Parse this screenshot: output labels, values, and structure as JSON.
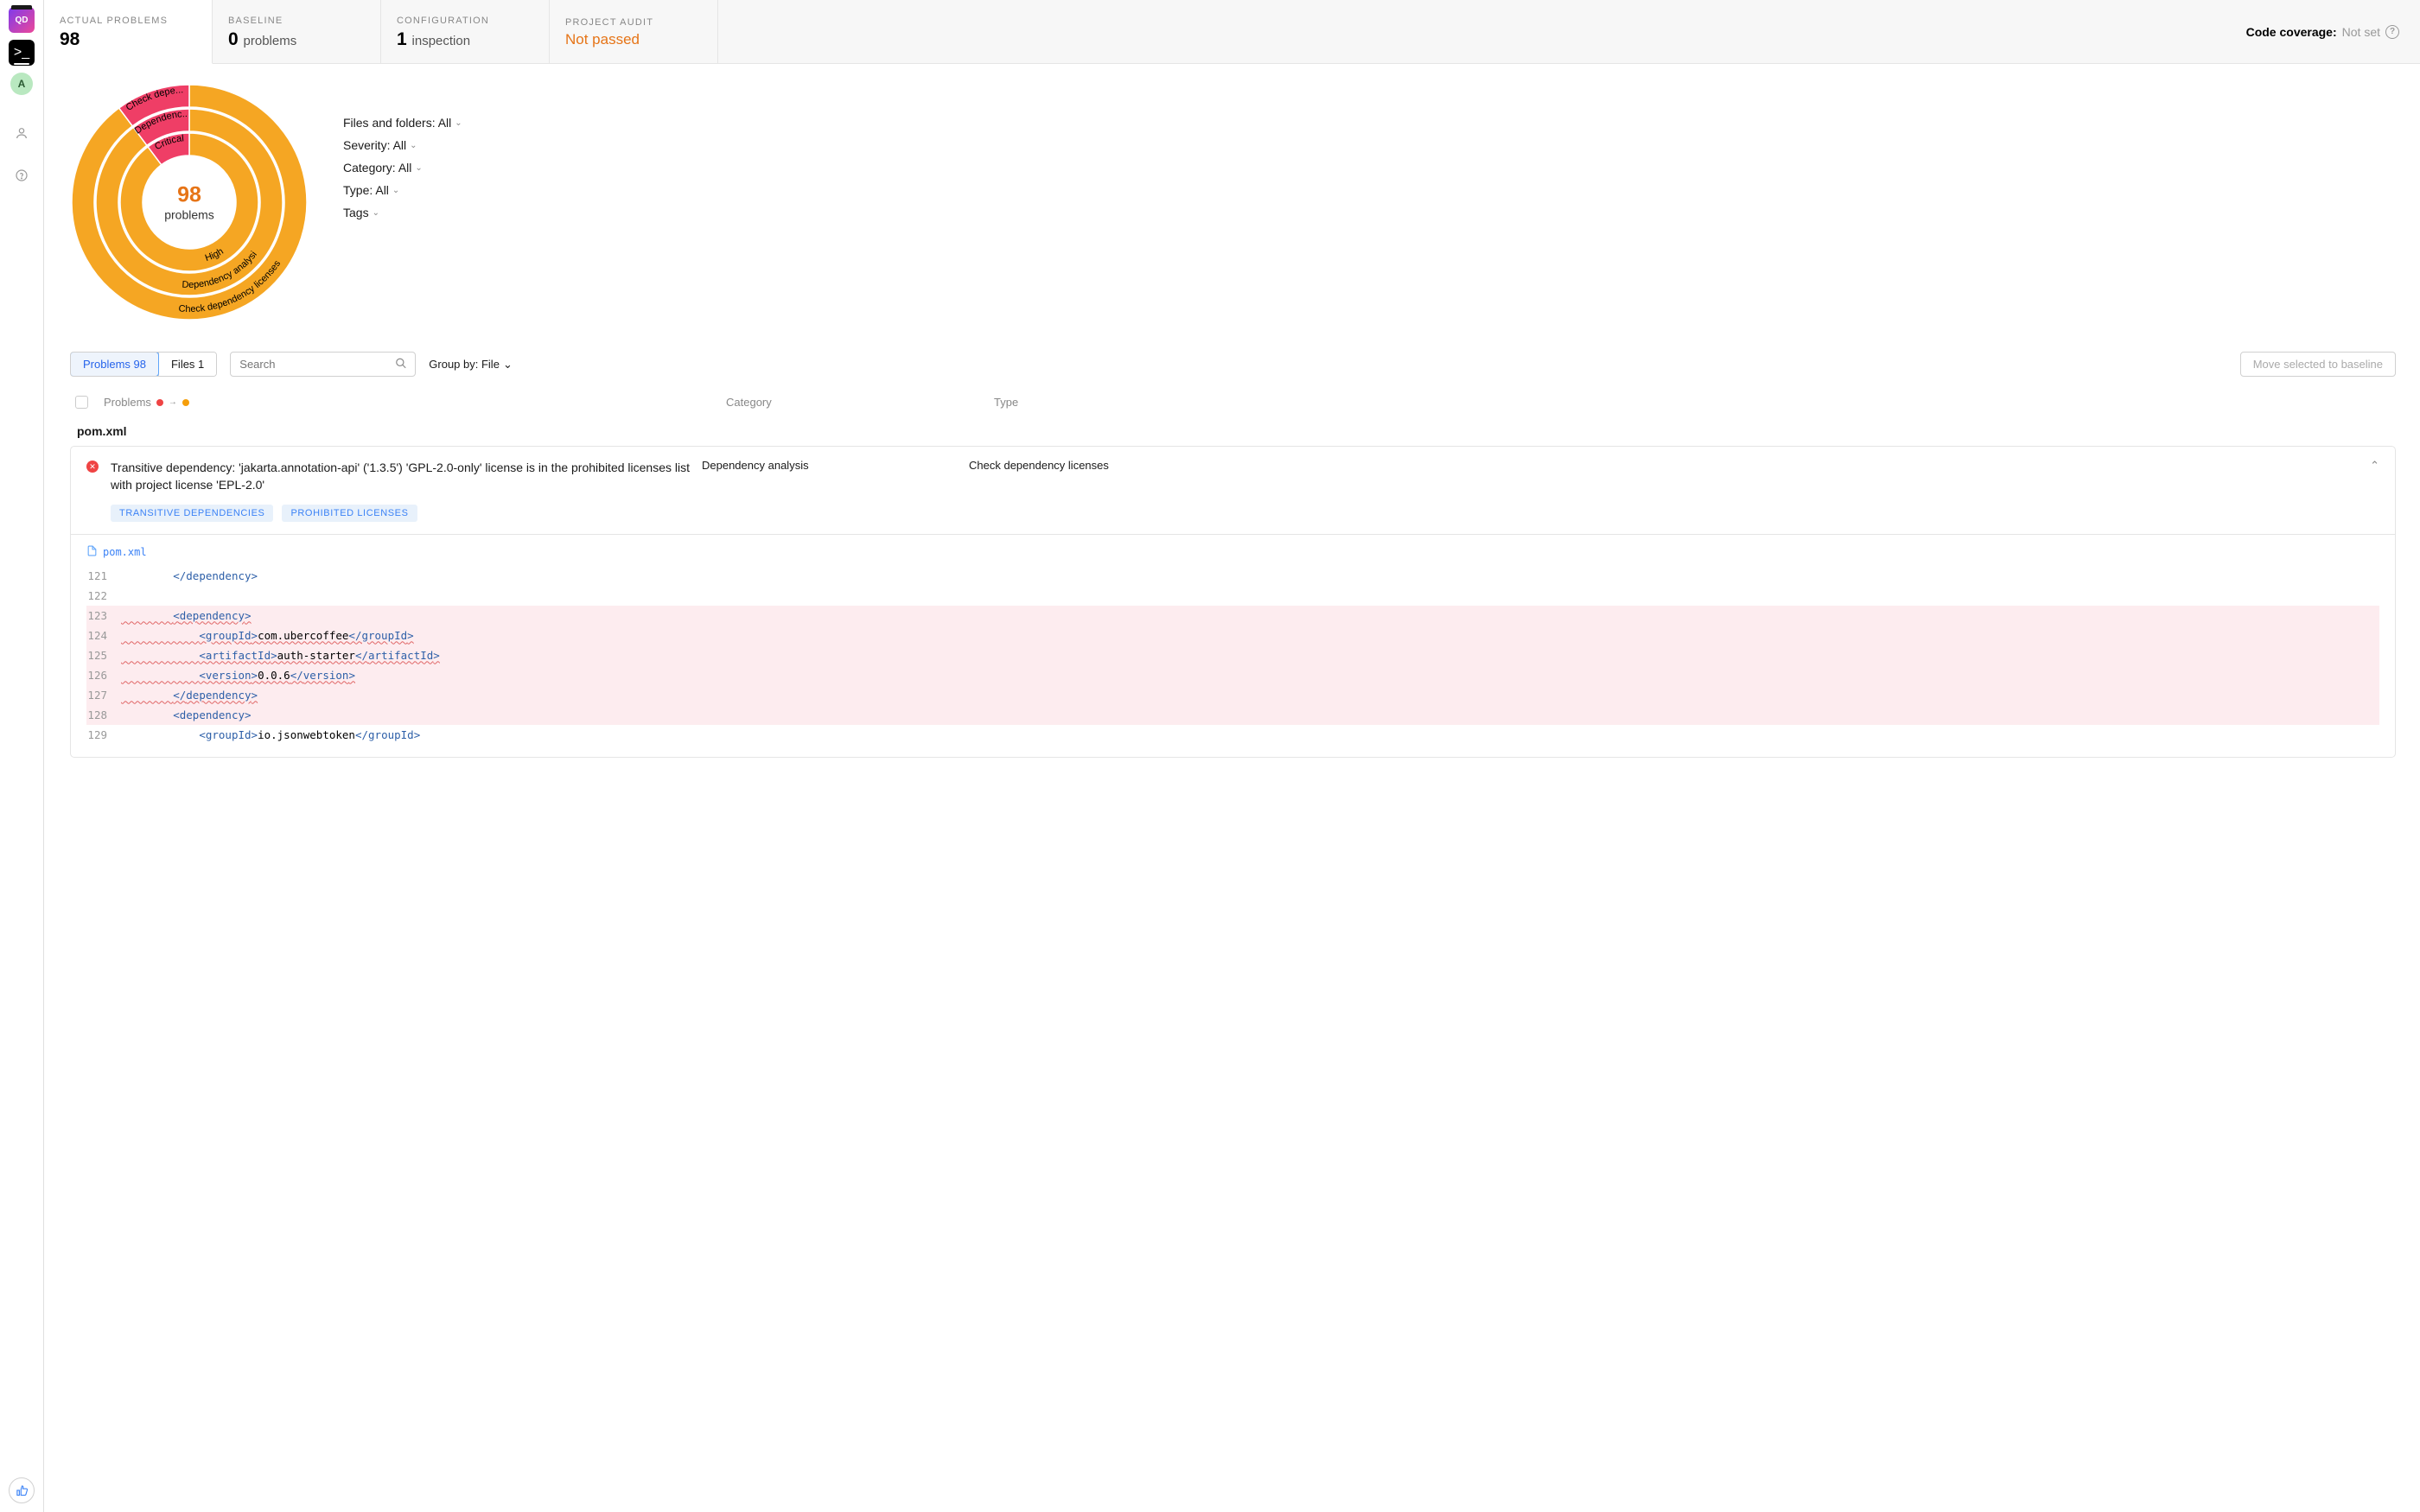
{
  "sidebar": {
    "qd": "QD",
    "term": ">_",
    "avatar": "A"
  },
  "tabs": [
    {
      "label": "ACTUAL PROBLEMS",
      "value": "98",
      "sub": ""
    },
    {
      "label": "BASELINE",
      "value": "0",
      "sub": "problems"
    },
    {
      "label": "CONFIGURATION",
      "value": "1",
      "sub": "inspection"
    },
    {
      "label": "PROJECT AUDIT",
      "value": "Not passed",
      "warn": true
    }
  ],
  "coverage": {
    "label": "Code coverage:",
    "value": "Not set"
  },
  "donut": {
    "count": "98",
    "label": "problems"
  },
  "chart_data": {
    "type": "pie",
    "title": "",
    "series_ring_outer": [
      {
        "name": "Check dependency licenses",
        "value": 88,
        "color": "#f5a623"
      },
      {
        "name": "Check depe...",
        "value": 10,
        "color": "#ef3e66"
      }
    ],
    "series_ring_middle": [
      {
        "name": "Dependency analysis",
        "value": 88,
        "color": "#f5a623"
      },
      {
        "name": "Dependenc...",
        "value": 10,
        "color": "#ef3e66"
      }
    ],
    "series_ring_inner": [
      {
        "name": "High",
        "value": 88,
        "color": "#f5a623"
      },
      {
        "name": "Critical",
        "value": 10,
        "color": "#ef3e66"
      }
    ]
  },
  "filters": {
    "files": "Files and folders: All",
    "severity": "Severity: All",
    "category": "Category: All",
    "type": "Type: All",
    "tags": "Tags"
  },
  "subtabs": {
    "problems": "Problems 98",
    "files": "Files 1"
  },
  "search_placeholder": "Search",
  "groupby": "Group by: File",
  "baseline_btn": "Move selected to baseline",
  "headers": {
    "problems": "Problems",
    "category": "Category",
    "type": "Type"
  },
  "file_group": "pom.xml",
  "issue": {
    "title": "Transitive dependency: 'jakarta.annotation-api' ('1.3.5') 'GPL-2.0-only' license is in the prohibited licenses list with project license 'EPL-2.0'",
    "category": "Dependency analysis",
    "type": "Check dependency licenses",
    "tags": [
      "TRANSITIVE DEPENDENCIES",
      "PROHIBITED LICENSES"
    ],
    "file": "pom.xml"
  },
  "code": [
    {
      "n": "121",
      "hl": false,
      "indent": "        ",
      "segs": [
        {
          "t": "br",
          "v": "</"
        },
        {
          "t": "tag",
          "v": "dependency"
        },
        {
          "t": "br",
          "v": ">"
        }
      ]
    },
    {
      "n": "122",
      "hl": false,
      "indent": "",
      "segs": []
    },
    {
      "n": "123",
      "hl": true,
      "sqg": true,
      "indent": "        ",
      "segs": [
        {
          "t": "br",
          "v": "<"
        },
        {
          "t": "tag",
          "v": "dependency"
        },
        {
          "t": "br",
          "v": ">"
        }
      ]
    },
    {
      "n": "124",
      "hl": true,
      "sqg": true,
      "indent": "            ",
      "segs": [
        {
          "t": "br",
          "v": "<"
        },
        {
          "t": "tag",
          "v": "groupId"
        },
        {
          "t": "br",
          "v": ">"
        },
        {
          "t": "txt",
          "v": "com.ubercoffee"
        },
        {
          "t": "br",
          "v": "</"
        },
        {
          "t": "tag",
          "v": "groupId"
        },
        {
          "t": "br",
          "v": ">"
        }
      ]
    },
    {
      "n": "125",
      "hl": true,
      "sqg": true,
      "indent": "            ",
      "segs": [
        {
          "t": "br",
          "v": "<"
        },
        {
          "t": "tag",
          "v": "artifactId"
        },
        {
          "t": "br",
          "v": ">"
        },
        {
          "t": "txt",
          "v": "auth-starter"
        },
        {
          "t": "br",
          "v": "</"
        },
        {
          "t": "tag",
          "v": "artifactId"
        },
        {
          "t": "br",
          "v": ">"
        }
      ]
    },
    {
      "n": "126",
      "hl": true,
      "sqg": true,
      "indent": "            ",
      "segs": [
        {
          "t": "br",
          "v": "<"
        },
        {
          "t": "tag",
          "v": "version"
        },
        {
          "t": "br",
          "v": ">"
        },
        {
          "t": "txt",
          "v": "0.0.6"
        },
        {
          "t": "br",
          "v": "</"
        },
        {
          "t": "tag",
          "v": "version"
        },
        {
          "t": "br",
          "v": ">"
        }
      ]
    },
    {
      "n": "127",
      "hl": true,
      "sqg": true,
      "indent": "        ",
      "segs": [
        {
          "t": "br",
          "v": "</"
        },
        {
          "t": "tag",
          "v": "dependency"
        },
        {
          "t": "br",
          "v": ">"
        }
      ]
    },
    {
      "n": "128",
      "hl": true,
      "indent": "        ",
      "segs": [
        {
          "t": "br",
          "v": "<"
        },
        {
          "t": "tag",
          "v": "dependency"
        },
        {
          "t": "br",
          "v": ">"
        }
      ]
    },
    {
      "n": "129",
      "hl": false,
      "indent": "            ",
      "segs": [
        {
          "t": "br",
          "v": "<"
        },
        {
          "t": "tag",
          "v": "groupId"
        },
        {
          "t": "br",
          "v": ">"
        },
        {
          "t": "txt",
          "v": "io.jsonwebtoken"
        },
        {
          "t": "br",
          "v": "</"
        },
        {
          "t": "tag",
          "v": "groupId"
        },
        {
          "t": "br",
          "v": ">"
        }
      ]
    }
  ]
}
